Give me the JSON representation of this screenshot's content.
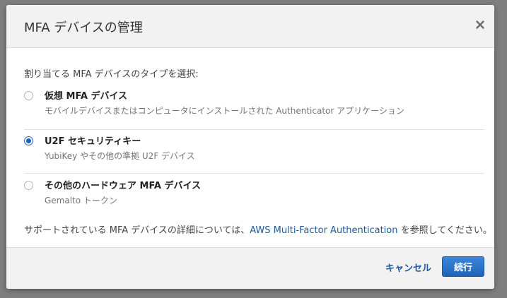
{
  "dialog": {
    "title": "MFA デバイスの管理",
    "prompt": "割り当てる MFA デバイスのタイプを選択:",
    "options": [
      {
        "title": "仮想 MFA デバイス",
        "description": "モバイルデバイスまたはコンピュータにインストールされた Authenticator アプリケーション",
        "selected": false
      },
      {
        "title": "U2F セキュリティキー",
        "description": "YubiKey やその他の準拠 U2F デバイス",
        "selected": true
      },
      {
        "title": "その他のハードウェア MFA デバイス",
        "description": "Gemalto トークン",
        "selected": false
      }
    ],
    "info_prefix": "サポートされている MFA デバイスの詳細については、",
    "info_link": "AWS Multi-Factor Authentication",
    "info_suffix": " を参照してください。",
    "cancel_label": "キャンセル",
    "continue_label": "続行"
  },
  "colors": {
    "primary": "#2e74cc",
    "link": "#1b5a9e",
    "header_bg": "#f2f2f2",
    "overlay": "#7f7f7f"
  }
}
